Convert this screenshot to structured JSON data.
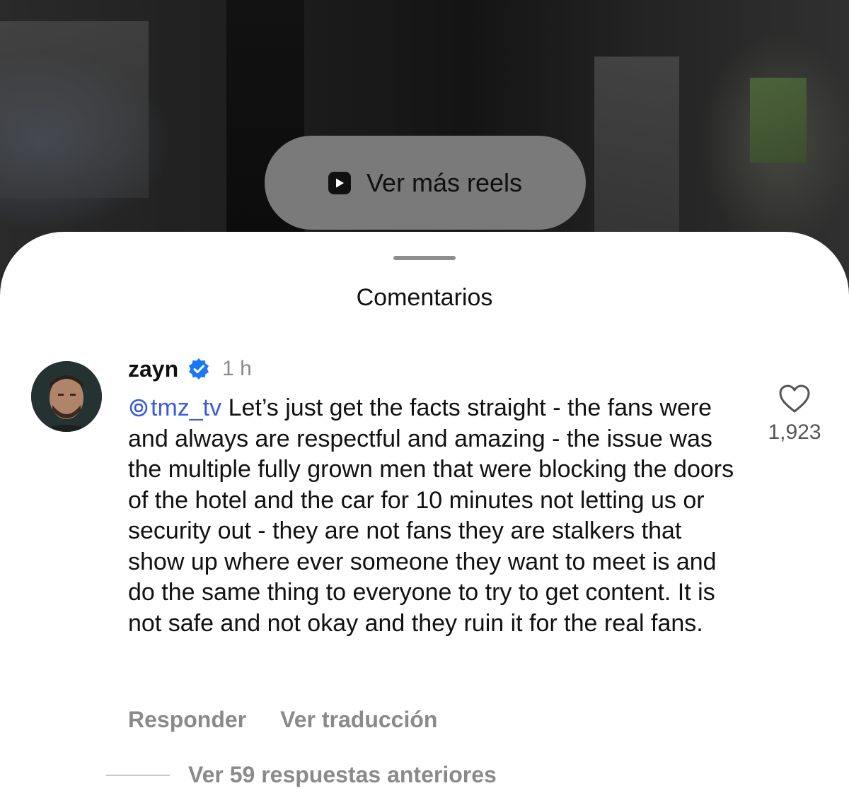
{
  "video": {
    "reels_button_label": "Ver más reels",
    "reels_icon": "reels-play-icon"
  },
  "sheet": {
    "title": "Comentarios"
  },
  "comment": {
    "username": "zayn",
    "verified_icon": "verified-badge-icon",
    "timestamp": "1 h",
    "mention": "tmz_tv",
    "mention_icon": "threads-icon",
    "text": "Let’s just get the facts straight - the fans were and always are respectful and amazing - the issue was the multiple fully grown men that were blocking the doors of the hotel and the car for 10 minutes not letting us or security out - they are not fans they are stalkers that show up where ever someone they want to meet is and do the same thing to everyone to try to get content. It is not safe and not okay and they ruin it for the real fans.",
    "like_icon": "heart-icon",
    "like_count": "1,923",
    "reply_label": "Responder",
    "translate_label": "Ver traducción",
    "view_replies_label": "Ver 59 respuestas anteriores"
  },
  "colors": {
    "mention": "#3b5bdb",
    "verified": "#1877f2",
    "muted_text": "#8a8a8a",
    "pill_bg": "#7a7a7a"
  }
}
